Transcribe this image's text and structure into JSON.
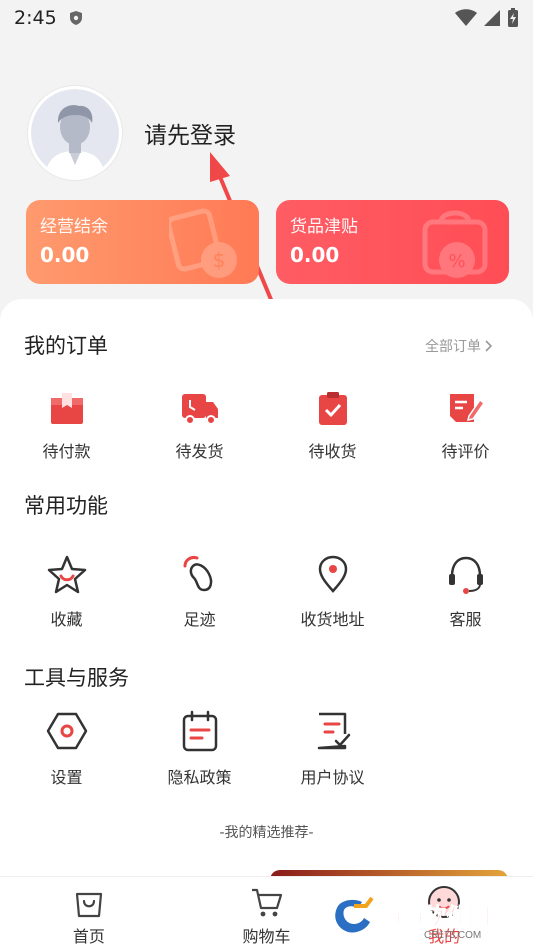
{
  "status_bar": {
    "time": "2:45"
  },
  "profile": {
    "login_text": "请先登录"
  },
  "cards": [
    {
      "title": "经营结余",
      "value": "0.00"
    },
    {
      "title": "货品津贴",
      "value": "0.00"
    }
  ],
  "orders": {
    "title": "我的订单",
    "all_link": "全部订单",
    "items": [
      {
        "label": "待付款",
        "icon": "payment-pending-icon"
      },
      {
        "label": "待发货",
        "icon": "delivery-truck-icon"
      },
      {
        "label": "待收货",
        "icon": "clipboard-check-icon"
      },
      {
        "label": "待评价",
        "icon": "review-pen-icon"
      }
    ]
  },
  "common": {
    "title": "常用功能",
    "items": [
      {
        "label": "收藏",
        "icon": "star-icon"
      },
      {
        "label": "足迹",
        "icon": "footprint-icon"
      },
      {
        "label": "收货地址",
        "icon": "location-pin-icon"
      },
      {
        "label": "客服",
        "icon": "headset-icon"
      }
    ]
  },
  "tools": {
    "title": "工具与服务",
    "items": [
      {
        "label": "设置",
        "icon": "settings-hexagon-icon"
      },
      {
        "label": "隐私政策",
        "icon": "calendar-doc-icon"
      },
      {
        "label": "用户协议",
        "icon": "agreement-doc-icon"
      }
    ]
  },
  "recommend_text": "-我的精选推荐-",
  "tabbar": [
    {
      "label": "首页",
      "icon": "shopping-bag-icon"
    },
    {
      "label": "购物车",
      "icon": "cart-icon"
    },
    {
      "label": "我的",
      "icon": "profile-face-icon"
    }
  ],
  "watermark": {
    "brand": "西西软件园",
    "url": "CR173.COM"
  },
  "colors": {
    "accent": "#e84545",
    "card_left": "#ff8a5f",
    "card_right": "#ff525b"
  }
}
